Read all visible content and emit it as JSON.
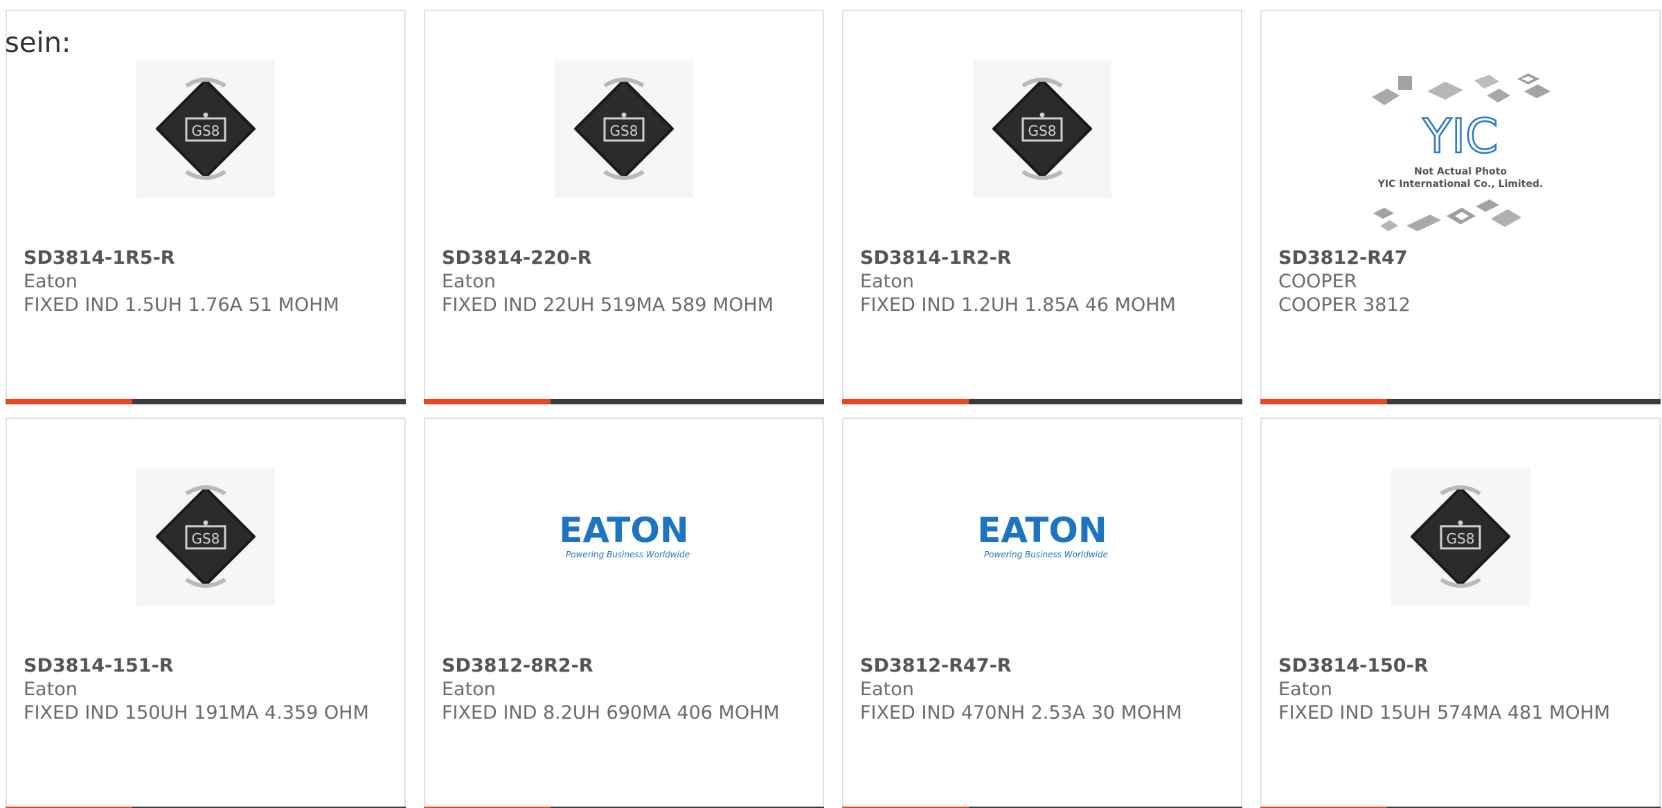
{
  "lead_text": "sein:",
  "colors": {
    "accent_bar": "#e8461f",
    "dark_bar": "#3c3c3c",
    "card_border": "#e1e1e1",
    "eaton_blue": "#1f74c2",
    "yic_blue": "#2a78c6"
  },
  "products": [
    {
      "part": "SD3814-1R5-R",
      "maker": "Eaton",
      "desc": "FIXED IND 1.5UH 1.76A 51 MOHM",
      "image": "inductor-gs8"
    },
    {
      "part": "SD3814-220-R",
      "maker": "Eaton",
      "desc": "FIXED IND 22UH 519MA 589 MOHM",
      "image": "inductor-gs8"
    },
    {
      "part": "SD3814-1R2-R",
      "maker": "Eaton",
      "desc": "FIXED IND 1.2UH 1.85A 46 MOHM",
      "image": "inductor-gs8"
    },
    {
      "part": "SD3812-R47",
      "maker": "COOPER",
      "desc": "COOPER 3812",
      "image": "yic-placeholder"
    },
    {
      "part": "SD3814-151-R",
      "maker": "Eaton",
      "desc": "FIXED IND 150UH 191MA 4.359 OHM",
      "image": "inductor-gs8"
    },
    {
      "part": "SD3812-8R2-R",
      "maker": "Eaton",
      "desc": "FIXED IND 8.2UH 690MA 406 MOHM",
      "image": "eaton-logo"
    },
    {
      "part": "SD3812-R47-R",
      "maker": "Eaton",
      "desc": "FIXED IND 470NH 2.53A 30 MOHM",
      "image": "eaton-logo"
    },
    {
      "part": "SD3814-150-R",
      "maker": "Eaton",
      "desc": "FIXED IND 15UH 574MA 481 MOHM",
      "image": "inductor-gs8"
    }
  ],
  "image_text": {
    "inductor_marking": "GS8",
    "yic_logo": "YIC",
    "yic_caption_1": "Not Actual Photo",
    "yic_caption_2": "YIC International Co., Limited.",
    "eaton_logo": "EATON",
    "eaton_tagline": "Powering Business Worldwide"
  }
}
